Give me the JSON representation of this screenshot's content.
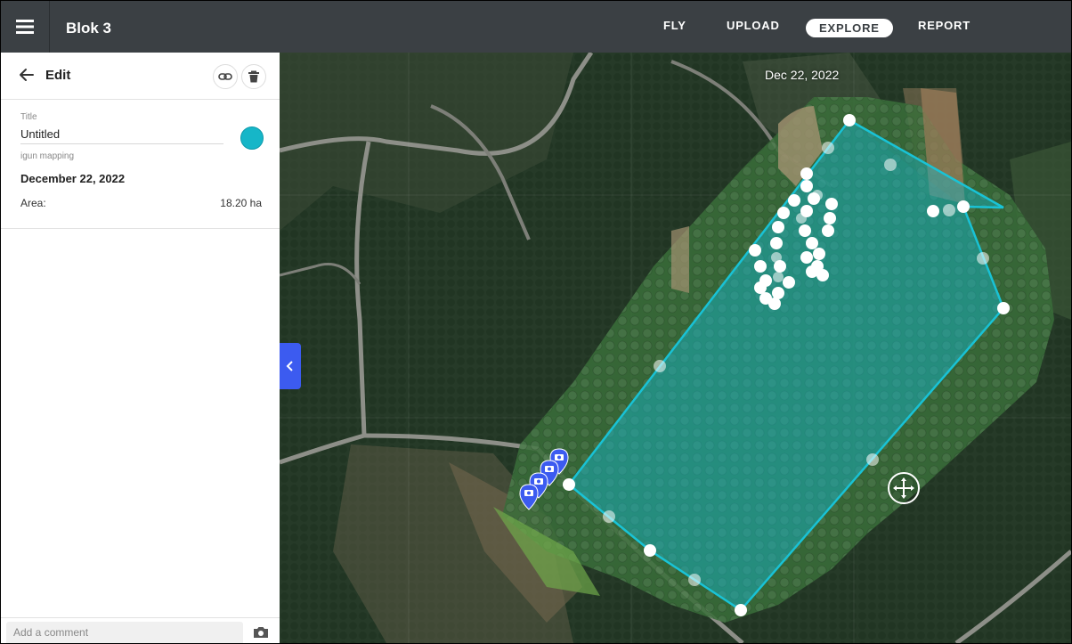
{
  "app": {
    "project_title": "Blok 3",
    "nav": [
      "FLY",
      "UPLOAD",
      "EXPLORE",
      "REPORT"
    ],
    "active_nav": "EXPLORE"
  },
  "panel": {
    "header_label": "Edit",
    "title_label": "Title",
    "title_value": "Untitled",
    "subtitle": "igun mapping",
    "date": "December 22, 2022",
    "area_label": "Area:",
    "area_value": "18.20 ha",
    "shape_color": "#16b6c8",
    "icons": [
      "back-arrow-icon",
      "link-icon",
      "trash-icon",
      "camera-icon"
    ]
  },
  "comment": {
    "placeholder": "Add a comment"
  },
  "map": {
    "date_label": "Dec 22, 2022",
    "photo_markers": 4,
    "icons": [
      "chevron-left-icon",
      "move-icon",
      "camera-marker-icon"
    ]
  }
}
